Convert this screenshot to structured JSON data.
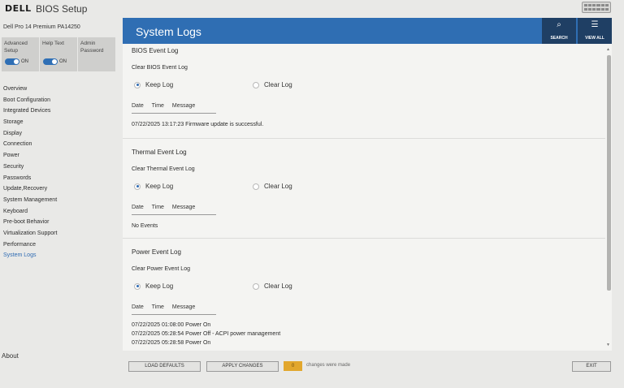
{
  "app": {
    "logo": "DELL",
    "title": "BIOS Setup"
  },
  "sidebar": {
    "device_name": "Dell Pro 14 Premium PA14250",
    "quick": [
      {
        "label": "Advanced Setup",
        "toggle": "ON"
      },
      {
        "label": "Help Text",
        "toggle": "ON"
      },
      {
        "label": "Admin Password"
      }
    ],
    "items": [
      "Overview",
      "Boot Configuration",
      "Integrated Devices",
      "Storage",
      "Display",
      "Connection",
      "Power",
      "Security",
      "Passwords",
      "Update,Recovery",
      "System Management",
      "Keyboard",
      "Pre-boot Behavior",
      "Virtualization Support",
      "Performance",
      "System Logs"
    ],
    "active_item": "System Logs",
    "about": "About"
  },
  "header": {
    "title": "System Logs",
    "search_label": "SEARCH",
    "view_all_label": "VIEW ALL",
    "search_icon": "search-icon",
    "view_all_icon": "filter-list-icon"
  },
  "columns": {
    "date": "Date",
    "time": "Time",
    "message": "Message"
  },
  "sections": {
    "bios": {
      "title": "BIOS Event Log",
      "subtitle": "Clear BIOS Event Log",
      "keep": "Keep Log",
      "clear": "Clear Log",
      "selected": "Keep Log",
      "entries": [
        "07/22/2025 13:17:23 Firmware update is successful."
      ]
    },
    "thermal": {
      "title": "Thermal Event Log",
      "subtitle": "Clear Thermal Event Log",
      "keep": "Keep Log",
      "clear": "Clear Log",
      "selected": "Keep Log",
      "entries": [
        "No Events"
      ]
    },
    "power": {
      "title": "Power Event Log",
      "subtitle": "Clear Power Event Log",
      "keep": "Keep Log",
      "clear": "Clear Log",
      "selected": "Keep Log",
      "entries": [
        "07/22/2025 01:08:00 Power On",
        "07/22/2025 05:28:54 Power Off - ACPI power management",
        "07/22/2025 05:28:58 Power On"
      ]
    }
  },
  "footer": {
    "load_defaults": "LOAD DEFAULTS",
    "apply_changes": "APPLY CHANGES",
    "changes_count": "0",
    "changes_text": "changes were made",
    "exit": "EXIT"
  },
  "colors": {
    "accent": "#2f6eb3",
    "header_dark": "#1f3f64",
    "badge": "#e2a72d"
  }
}
